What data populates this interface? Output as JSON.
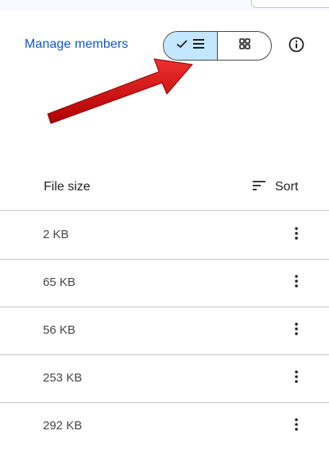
{
  "toolbar": {
    "manage_members_label": "Manage members",
    "view_toggle": {
      "selected": "list",
      "options": [
        "list",
        "grid"
      ]
    },
    "info_icon": "info-icon"
  },
  "table": {
    "columns": {
      "file_size": "File size",
      "sort": "Sort"
    },
    "rows": [
      {
        "size": "2 KB"
      },
      {
        "size": "65 KB"
      },
      {
        "size": "56 KB"
      },
      {
        "size": "253 KB"
      },
      {
        "size": "292 KB"
      }
    ]
  },
  "colors": {
    "link": "#0b57d0",
    "selected_toggle": "#c2e7ff",
    "annotation_arrow": "#e01010",
    "divider": "#c4c7c5"
  }
}
